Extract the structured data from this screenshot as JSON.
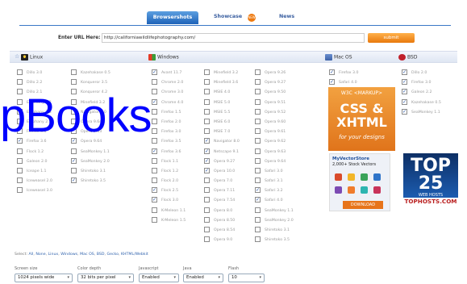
{
  "tabs": {
    "browsershots": "Browsershots",
    "showcase": "Showcase",
    "news": "News",
    "new_badge": "NEW"
  },
  "url": {
    "label": "Enter URL Here:",
    "value": "http://californiawildlifephotography.com/"
  },
  "submit_label": "submit",
  "os": {
    "linux": "Linux",
    "windows": "Windows",
    "mac": "Mac OS",
    "bsd": "BSD"
  },
  "columns": [
    {
      "items": [
        {
          "label": "Dillo 3.0",
          "checked": false
        },
        {
          "label": "Dillo 2.2",
          "checked": false
        },
        {
          "label": "Dillo 2.1",
          "checked": false
        },
        {
          "label": "Epiphany 2.2",
          "checked": false
        },
        {
          "label": "Epiphany 2.3",
          "checked": false
        },
        {
          "label": "Epiphany 2.8",
          "checked": false
        },
        {
          "label": "Firefox 3.1",
          "checked": false
        },
        {
          "label": "Firefox 3.6",
          "checked": true
        },
        {
          "label": "Flock 1.2",
          "checked": false
        },
        {
          "label": "Galeon 2.0",
          "checked": false
        },
        {
          "label": "Iceape 1.1",
          "checked": false
        },
        {
          "label": "Iceweasel 2.0",
          "checked": false
        },
        {
          "label": "Iceweasel 3.0",
          "checked": false
        }
      ]
    },
    {
      "items": [
        {
          "label": "Kazehakase 0.5",
          "checked": false
        },
        {
          "label": "Konqueror 3.5",
          "checked": false
        },
        {
          "label": "Konqueror 4.2",
          "checked": false
        },
        {
          "label": "Minefield 3.2",
          "checked": false
        },
        {
          "label": "Navigator 9.0",
          "checked": false
        },
        {
          "label": "Opera 9.64",
          "checked": false
        },
        {
          "label": "Opera 9.63",
          "checked": false
        },
        {
          "label": "Opera 9.64",
          "checked": true
        },
        {
          "label": "SeaMonkey 1.1",
          "checked": false
        },
        {
          "label": "SeaMonkey 2.0",
          "checked": true
        },
        {
          "label": "Shiretoko 3.1",
          "checked": false
        },
        {
          "label": "Shiretoko 3.5",
          "checked": true
        }
      ]
    },
    {
      "items": [
        {
          "label": "Avant 11.7",
          "checked": true
        },
        {
          "label": "Chrome 2.0",
          "checked": false
        },
        {
          "label": "Chrome 3.0",
          "checked": false
        },
        {
          "label": "Chrome 4.0",
          "checked": true
        },
        {
          "label": "Firefox 1.5",
          "checked": false
        },
        {
          "label": "Firefox 2.0",
          "checked": false
        },
        {
          "label": "Firefox 3.0",
          "checked": false
        },
        {
          "label": "Firefox 3.5",
          "checked": false
        },
        {
          "label": "Firefox 3.6",
          "checked": true
        },
        {
          "label": "Flock 1.1",
          "checked": false
        },
        {
          "label": "Flock 1.2",
          "checked": false
        },
        {
          "label": "Flock 2.0",
          "checked": false
        },
        {
          "label": "Flock 2.5",
          "checked": true
        },
        {
          "label": "Flock 3.0",
          "checked": true
        },
        {
          "label": "K-Meleon 1.1",
          "checked": false
        },
        {
          "label": "K-Meleon 1.5",
          "checked": false
        }
      ]
    },
    {
      "items": [
        {
          "label": "Minefield 3.2",
          "checked": false
        },
        {
          "label": "Minefield 3.6",
          "checked": false
        },
        {
          "label": "MSIE 4.0",
          "checked": false
        },
        {
          "label": "MSIE 5.0",
          "checked": false
        },
        {
          "label": "MSIE 5.5",
          "checked": false
        },
        {
          "label": "MSIE 6.0",
          "checked": false
        },
        {
          "label": "MSIE 7.0",
          "checked": false
        },
        {
          "label": "Navigator 8.0",
          "checked": true
        },
        {
          "label": "Netscape 9.1",
          "checked": true
        },
        {
          "label": "Opera 9.27",
          "checked": true
        },
        {
          "label": "Opera 10.0",
          "checked": true
        },
        {
          "label": "Opera 7.0",
          "checked": false
        },
        {
          "label": "Opera 7.11",
          "checked": false
        },
        {
          "label": "Opera 7.54",
          "checked": false
        },
        {
          "label": "Opera 8.0",
          "checked": false
        },
        {
          "label": "Opera 8.50",
          "checked": false
        },
        {
          "label": "Opera 8.54",
          "checked": false
        },
        {
          "label": "Opera 9.0",
          "checked": false
        }
      ]
    },
    {
      "items": [
        {
          "label": "Opera 9.26",
          "checked": false
        },
        {
          "label": "Opera 9.27",
          "checked": false
        },
        {
          "label": "Opera 9.50",
          "checked": false
        },
        {
          "label": "Opera 9.51",
          "checked": false
        },
        {
          "label": "Opera 9.52",
          "checked": false
        },
        {
          "label": "Opera 9.60",
          "checked": false
        },
        {
          "label": "Opera 9.61",
          "checked": false
        },
        {
          "label": "Opera 9.62",
          "checked": false
        },
        {
          "label": "Opera 9.63",
          "checked": false
        },
        {
          "label": "Opera 9.64",
          "checked": false
        },
        {
          "label": "Safari 3.0",
          "checked": false
        },
        {
          "label": "Safari 3.1",
          "checked": false
        },
        {
          "label": "Safari 3.2",
          "checked": true
        },
        {
          "label": "Safari 4.0",
          "checked": true
        },
        {
          "label": "SeaMonkey 1.1",
          "checked": false
        },
        {
          "label": "SeaMonkey 2.0",
          "checked": false
        },
        {
          "label": "Shiretoko 3.1",
          "checked": false
        },
        {
          "label": "Shiretoko 3.5",
          "checked": false
        }
      ]
    },
    {
      "items": [
        {
          "label": "Firefox 3.0",
          "checked": true
        },
        {
          "label": "Safari 4.0",
          "checked": true
        }
      ]
    },
    {
      "items": [
        {
          "label": "Dillo 2.0",
          "checked": true
        },
        {
          "label": "Firefox 3.0",
          "checked": true
        },
        {
          "label": "Galeon 2.2",
          "checked": true
        },
        {
          "label": "Kazehakase 0.5",
          "checked": true
        },
        {
          "label": "SeaMonkey 1.1",
          "checked": true
        }
      ]
    }
  ],
  "ads": {
    "ad1": {
      "line1": "W3C <MARKUP>",
      "line2": "CSS &",
      "line3": "XHTML",
      "line4": "for your designs"
    },
    "ad2": {
      "title": "MyVectorStore",
      "subtitle": "2,000+ Stock Vectors",
      "download": "DOWNLOAD"
    },
    "ad3": {
      "big": "TOP 25",
      "small": "WEB HOSTS",
      "footer": "TOPHOSTS.COM"
    }
  },
  "select_line": {
    "prefix": "Select:",
    "links": [
      "All",
      "None",
      "Linux",
      "Windows",
      "Mac OS",
      "BSD",
      "Gecko",
      "KHTML/Webkit"
    ]
  },
  "settings": {
    "screen_size": {
      "label": "Screen size",
      "value": "1024 pixels wide"
    },
    "color_depth": {
      "label": "Color depth",
      "value": "32 bits per pixel"
    },
    "javascript": {
      "label": "Javascript",
      "value": "Enabled"
    },
    "java": {
      "label": "Java",
      "value": "Enabled"
    },
    "flash": {
      "label": "Flash",
      "value": "10"
    }
  },
  "watermark": "pBooks",
  "colors": {
    "accent": "#1f63b8",
    "orange": "#e8790d"
  }
}
